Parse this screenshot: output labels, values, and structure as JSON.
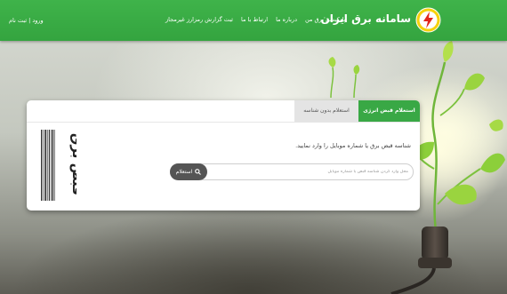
{
  "header": {
    "brand": "سامانه برق ایران",
    "nav": [
      "اپلیکیشن برق من",
      "درباره ما",
      "ارتباط با ما",
      "ثبت گزارش رمزارز غیرمجاز"
    ],
    "login": "ورود | ثبت نام"
  },
  "card": {
    "tabs": [
      {
        "label": "استعلام قبض انرژی",
        "active": true
      },
      {
        "label": "استعلام بدون شناسه",
        "active": false
      }
    ],
    "instruction": "شناسه قبض برق یا شماره موبایل را وارد نمایید.",
    "search": {
      "placeholder": "محل وارد کردن شناسه قبض یا شماره موبایل",
      "button_label": "استعلام"
    },
    "barcode_logo_text": "قبض برق"
  },
  "colors": {
    "brand_green": "#39a845",
    "button_dark": "#555555"
  },
  "icons": {
    "logo": "lightning-bolt-icon",
    "search": "search-icon"
  }
}
